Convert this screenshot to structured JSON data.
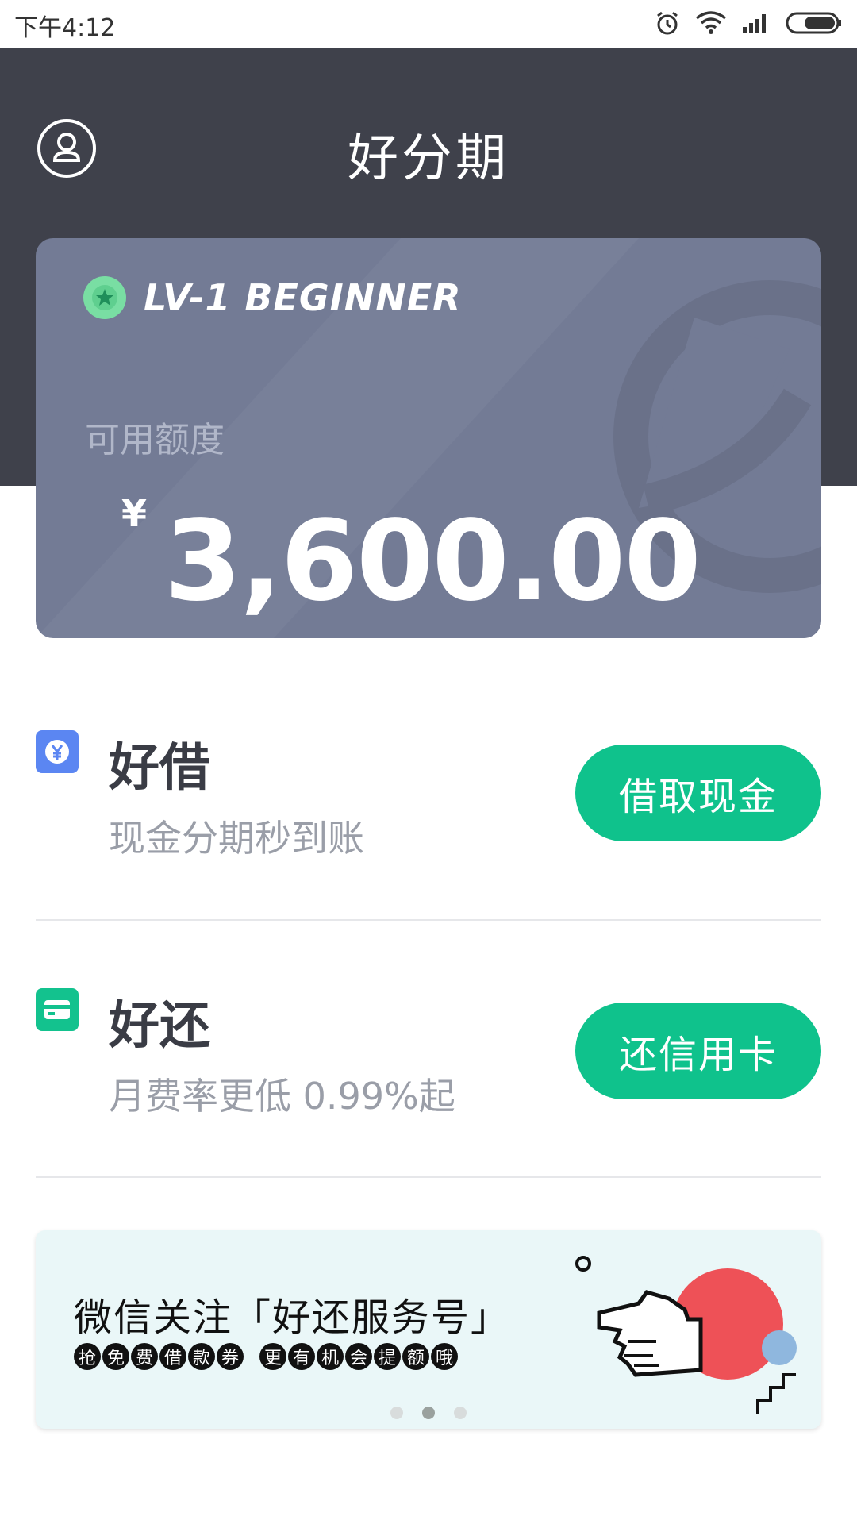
{
  "status_bar": {
    "time": "下午4:12"
  },
  "header": {
    "title": "好分期"
  },
  "card": {
    "level": "LV-1 BEGINNER",
    "credit_label": "可用额度",
    "currency": "¥",
    "amount": "3,600.00"
  },
  "services": [
    {
      "title": "好借",
      "subtitle": "现金分期秒到账",
      "button": "借取现金",
      "icon": "yen-icon",
      "icon_color": "#5b86f2"
    },
    {
      "title": "好还",
      "subtitle": "月费率更低 0.99%起",
      "button": "还信用卡",
      "icon": "credit-card-icon",
      "icon_color": "#13c28e"
    }
  ],
  "banner": {
    "line1": "微信关注「好还服务号」",
    "line2_a": [
      "抢",
      "免",
      "费",
      "借",
      "款",
      "券"
    ],
    "line2_b": [
      "更",
      "有",
      "机",
      "会",
      "提",
      "额",
      "哦"
    ],
    "page_count": 3,
    "active_page": 2
  },
  "colors": {
    "header_bg": "#3f414b",
    "card_bg": "#737b95",
    "accent_green": "#0fc28c",
    "badge_green": "#79dea3"
  }
}
